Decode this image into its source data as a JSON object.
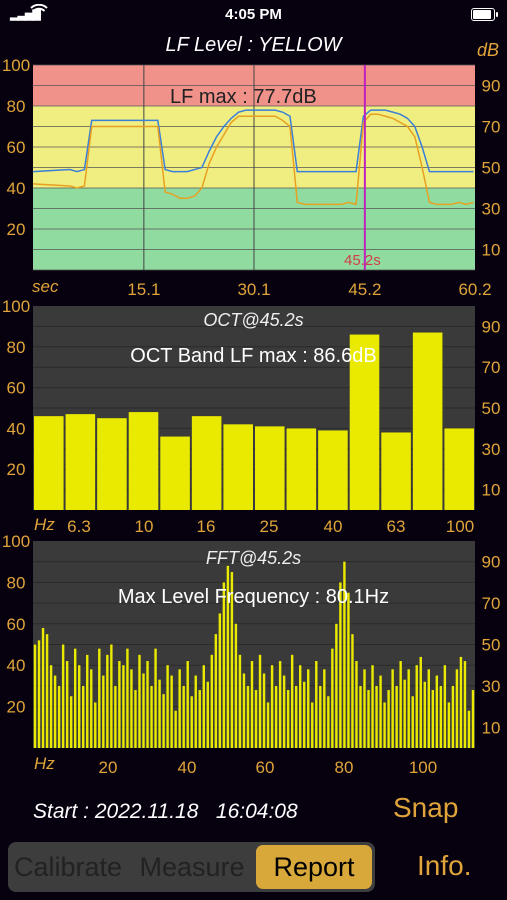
{
  "status_bar": {
    "time": "4:05 PM"
  },
  "level_chart": {
    "title": "LF Level : YELLOW",
    "unit": "dB",
    "annotation": "LF max : 77.7dB",
    "cursor_label": "45.2s",
    "x_unit": "sec",
    "x_ticks": [
      "15.1",
      "30.1",
      "45.2",
      "60.2"
    ],
    "y_left_ticks": [
      "100",
      "80",
      "60",
      "40",
      "20"
    ],
    "y_right_ticks": [
      "90",
      "70",
      "50",
      "30",
      "10"
    ]
  },
  "oct_chart": {
    "title": "OCT@45.2s",
    "annotation": "OCT Band LF max : 86.6dB",
    "x_unit": "Hz",
    "x_ticks": [
      "6.3",
      "10",
      "16",
      "25",
      "40",
      "63",
      "100"
    ],
    "y_left_ticks": [
      "100",
      "80",
      "60",
      "40",
      "20"
    ],
    "y_right_ticks": [
      "90",
      "70",
      "50",
      "30",
      "10"
    ]
  },
  "fft_chart": {
    "title": "FFT@45.2s",
    "annotation": "Max Level Frequency : 80.1Hz",
    "x_unit": "Hz",
    "x_ticks": [
      "20",
      "40",
      "60",
      "80",
      "100"
    ],
    "y_left_ticks": [
      "100",
      "80",
      "60",
      "40",
      "20"
    ],
    "y_right_ticks": [
      "90",
      "70",
      "50",
      "30",
      "10"
    ]
  },
  "footer": {
    "start_label": "Start : 2022.11.18   16:04:08",
    "snap_label": "Snap",
    "info_label": "Info."
  },
  "tabs": [
    {
      "label": "Calibrate",
      "active": false
    },
    {
      "label": "Measure",
      "active": false
    },
    {
      "label": "Report",
      "active": true
    }
  ],
  "colors": {
    "accent": "#e0a43a",
    "bar_yellow": "#eaea00",
    "zone_red": "#f0928a",
    "zone_yellow": "#f0ee80",
    "zone_green": "#90dca0",
    "blue_trace": "#3a7fd8",
    "orange_trace": "#e8a020",
    "cursor": "#c020c0"
  },
  "chart_data": [
    {
      "type": "line",
      "title": "LF Level : YELLOW",
      "xlabel": "sec",
      "ylabel": "dB",
      "xlim": [
        0,
        60.2
      ],
      "ylim": [
        0,
        100
      ],
      "cursor_x": 45.2,
      "series": [
        {
          "x": [
            0,
            5,
            6,
            7,
            8,
            9,
            10,
            11,
            12,
            13,
            14,
            15,
            16,
            17,
            18,
            19,
            20,
            21,
            22,
            23,
            24,
            25,
            26,
            27,
            28,
            29,
            30,
            31,
            32,
            33,
            34,
            35,
            36,
            37,
            38,
            39,
            40,
            41,
            42,
            43,
            44,
            45,
            46,
            47,
            48,
            49,
            50,
            51,
            52,
            53,
            54,
            55,
            56,
            57,
            58,
            59,
            60
          ],
          "values": [
            48,
            49,
            48,
            49,
            73,
            73,
            73,
            73,
            73,
            73,
            73,
            73,
            73,
            73,
            49,
            48,
            48,
            48,
            49,
            50,
            58,
            65,
            70,
            74,
            77,
            78,
            78,
            78,
            78,
            78,
            77,
            75,
            48,
            48,
            48,
            48,
            48,
            48,
            48,
            48,
            48,
            75,
            78,
            78,
            78,
            77,
            76,
            74,
            70,
            60,
            48,
            48,
            48,
            48,
            48,
            48,
            48
          ]
        },
        {
          "x": [
            0,
            5,
            6,
            7,
            8,
            9,
            10,
            11,
            12,
            13,
            14,
            15,
            16,
            17,
            18,
            19,
            20,
            21,
            22,
            23,
            24,
            25,
            26,
            27,
            28,
            29,
            30,
            31,
            32,
            33,
            34,
            35,
            36,
            37,
            38,
            39,
            40,
            41,
            42,
            43,
            44,
            45,
            46,
            47,
            48,
            49,
            50,
            51,
            52,
            53,
            54,
            55,
            56,
            57,
            58,
            59,
            60
          ],
          "values": [
            42,
            41,
            40,
            41,
            70,
            70,
            70,
            70,
            70,
            70,
            70,
            70,
            70,
            70,
            38,
            37,
            35,
            35,
            36,
            40,
            52,
            60,
            66,
            72,
            75,
            75,
            75,
            75,
            75,
            75,
            73,
            70,
            33,
            32,
            32,
            32,
            32,
            32,
            32,
            33,
            32,
            72,
            76,
            76,
            75,
            74,
            72,
            70,
            65,
            50,
            33,
            32,
            32,
            32,
            33,
            32,
            33
          ]
        }
      ],
      "y_zones": [
        {
          "from": 0,
          "to": 40,
          "color": "#90dca0"
        },
        {
          "from": 40,
          "to": 80,
          "color": "#f0ee80"
        },
        {
          "from": 80,
          "to": 100,
          "color": "#f0928a"
        }
      ]
    },
    {
      "type": "bar",
      "title": "OCT@45.2s",
      "xlabel": "Hz",
      "ylim": [
        0,
        100
      ],
      "values": [
        46,
        47,
        45,
        48,
        36,
        46,
        42,
        41,
        40,
        39,
        86,
        38,
        87,
        40
      ]
    },
    {
      "type": "bar",
      "title": "FFT@45.2s",
      "xlabel": "Hz",
      "ylim": [
        0,
        100
      ],
      "values": [
        50,
        52,
        58,
        55,
        40,
        35,
        30,
        50,
        42,
        25,
        48,
        40,
        30,
        45,
        38,
        22,
        48,
        35,
        45,
        50,
        30,
        42,
        40,
        48,
        38,
        28,
        45,
        36,
        42,
        30,
        48,
        33,
        26,
        40,
        35,
        18,
        38,
        30,
        42,
        25,
        35,
        28,
        40,
        32,
        45,
        55,
        65,
        80,
        88,
        85,
        60,
        45,
        36,
        30,
        42,
        28,
        45,
        36,
        22,
        40,
        30,
        42,
        35,
        28,
        45,
        30,
        40,
        32,
        38,
        22,
        42,
        30,
        38,
        25,
        48,
        60,
        80,
        90,
        75,
        55,
        42,
        30,
        38,
        28,
        40,
        30,
        35,
        22,
        28,
        38,
        30,
        42,
        33,
        38,
        25,
        40,
        44,
        32,
        38,
        28,
        35,
        30,
        40,
        22,
        30,
        38,
        44,
        42,
        18,
        28
      ]
    }
  ]
}
